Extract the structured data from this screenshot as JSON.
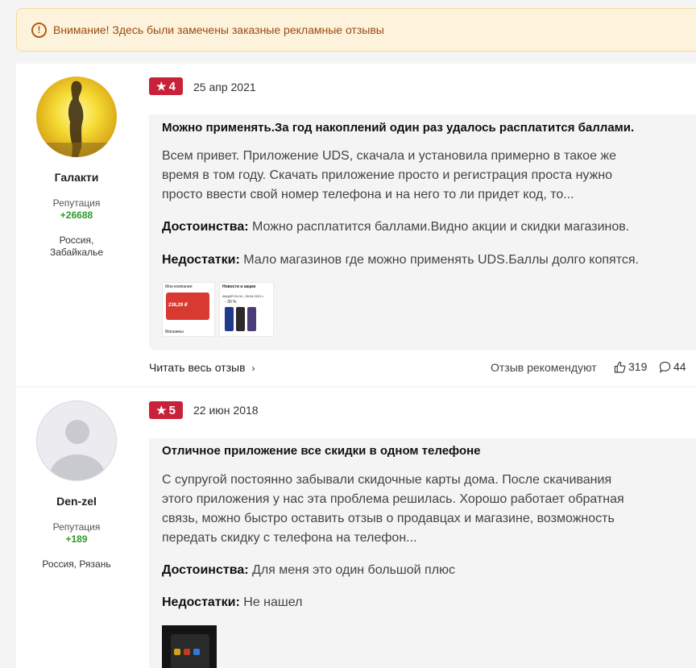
{
  "warning": {
    "icon": "alert-circle-icon",
    "text": "Внимание! Здесь были замечены заказные рекламные отзывы"
  },
  "reviews": [
    {
      "author": {
        "name": "Галакти",
        "reputation_label": "Репутация",
        "reputation": "+26688",
        "location_line1": "Россия,",
        "location_line2": "Забайкалье"
      },
      "rating": "4",
      "date": "25 апр 2021",
      "title": "Можно применять.За год накоплений один раз удалось расплатится баллами.",
      "text_lines": [
        "Всем привет. Приложение UDS, скачала и установила примерно в такое же",
        "время в том году. Скачать приложение просто и регистрация проста нужно",
        "просто ввести свой номер телефона и на него то ли придет код, то..."
      ],
      "pros_label": "Достоинства:",
      "pros": "Можно расплатится баллами.Видно акции и скидки магазинов.",
      "cons_label": "Недостатки:",
      "cons": "Мало магазинов где можно применять UDS.Баллы долго копятся.",
      "thumb1": {
        "title": "Мои компании",
        "amount": "238,29 ₽",
        "footer": "Магазины"
      },
      "thumb2": {
        "title": "Новости и акции",
        "promo": "АКЦИЯ 24.04 - 28.04.2021 г.",
        "discount": "- 30 %"
      },
      "read_more": "Читать весь отзыв",
      "recommend": "Отзыв рекомендуют",
      "likes": "319",
      "comments": "44"
    },
    {
      "author": {
        "name": "Den-zel",
        "reputation_label": "Репутация",
        "reputation": "+189",
        "location_line1": "Россия, Рязань"
      },
      "rating": "5",
      "date": "22 июн 2018",
      "title": "Отличное приложение все скидки в одном телефоне",
      "text_lines": [
        "С супругой постоянно забывали скидочные карты дома. После скачивания",
        "этого приложения у нас эта проблема решилась. Хорошо работает обратная",
        "связь, можно быстро оставить отзыв о продавцах и магазине, возможность",
        "передать скидку с телефона на телефон..."
      ],
      "pros_label": "Достоинства:",
      "pros": "Для меня это один большой плюс",
      "cons_label": "Недостатки:",
      "cons": "Не нашел"
    }
  ],
  "colors": {
    "rating_bg": "#c8223a",
    "reputation": "#2c9a2c",
    "warning_bg": "#fdf3dc",
    "warning_text": "#9a4a0e"
  }
}
